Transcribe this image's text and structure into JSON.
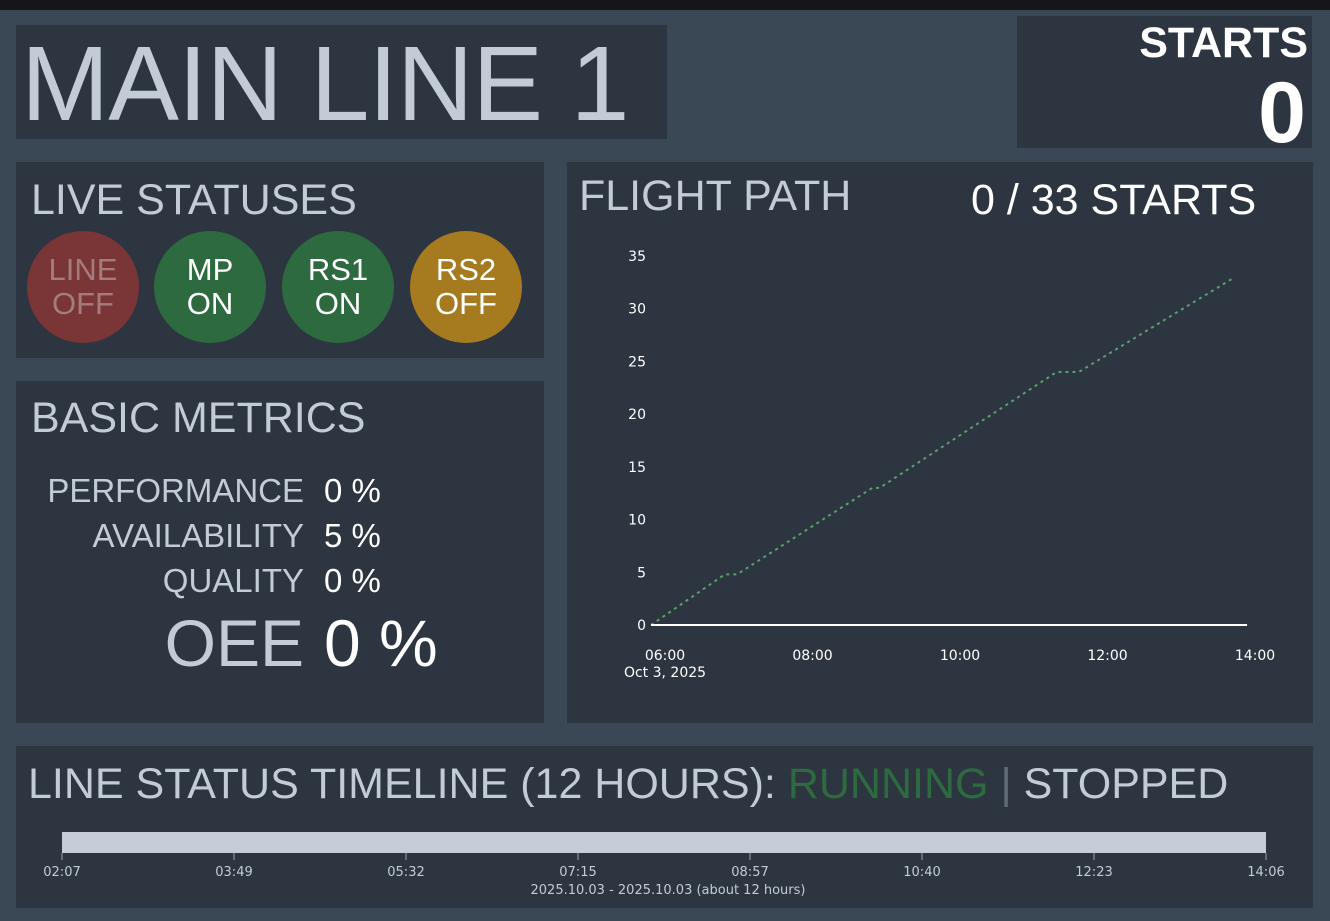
{
  "title": "MAIN LINE 1",
  "starts": {
    "label": "STARTS",
    "value": "0"
  },
  "live_statuses": {
    "title": "LIVE STATUSES",
    "items": [
      {
        "line1": "LINE",
        "line2": "OFF",
        "color": "#7a3536",
        "text_color": "#a57c7d"
      },
      {
        "line1": "MP",
        "line2": "ON",
        "color": "#2e6a3f",
        "text_color": "#ffffff"
      },
      {
        "line1": "RS1",
        "line2": "ON",
        "color": "#2e6a3f",
        "text_color": "#ffffff"
      },
      {
        "line1": "RS2",
        "line2": "OFF",
        "color": "#a67a1f",
        "text_color": "#ffffff"
      }
    ]
  },
  "metrics": {
    "title": "BASIC METRICS",
    "performance": {
      "label": "PERFORMANCE",
      "value": "0 %"
    },
    "availability": {
      "label": "AVAILABILITY",
      "value": "5 %"
    },
    "quality": {
      "label": "QUALITY",
      "value": "0 %"
    },
    "oee": {
      "label": "OEE",
      "value": "0 %"
    }
  },
  "flight_path": {
    "title": "FLIGHT PATH",
    "count_text": "0 / 33 STARTS"
  },
  "chart_data": {
    "type": "line",
    "x_tick_labels": [
      "06:00",
      "08:00",
      "10:00",
      "12:00",
      "14:00"
    ],
    "x_tick_sublabel": "Oct 3, 2025",
    "y_ticks": [
      0,
      5,
      10,
      15,
      20,
      25,
      30,
      35
    ],
    "ylim": [
      0,
      35
    ],
    "xlim": [
      "06:00",
      "14:00"
    ],
    "series": [
      {
        "style": "dotted",
        "color": "#5aa06a",
        "points": [
          {
            "x": "06:00",
            "y": 0
          },
          {
            "x": "07:00",
            "y": 4.8
          },
          {
            "x": "07:10",
            "y": 4.8
          },
          {
            "x": "09:00",
            "y": 13
          },
          {
            "x": "09:06",
            "y": 13
          },
          {
            "x": "11:30",
            "y": 24
          },
          {
            "x": "11:48",
            "y": 24
          },
          {
            "x": "13:55",
            "y": 33
          }
        ]
      },
      {
        "style": "solid",
        "color": "#ffffff",
        "points": [
          {
            "x": "06:00",
            "y": 0
          },
          {
            "x": "14:05",
            "y": 0
          }
        ]
      }
    ]
  },
  "timeline": {
    "title": "LINE STATUS TIMELINE (12 HOURS):",
    "running_label": "RUNNING",
    "separator": "|",
    "stopped_label": "STOPPED",
    "running_color": "#2e6a3f",
    "bar_color": "#c5ced8",
    "tick_labels": [
      "02:07",
      "03:49",
      "05:32",
      "07:15",
      "08:57",
      "10:40",
      "12:23",
      "14:06"
    ],
    "range_label": "2025.10.03 - 2025.10.03 (about 12 hours)"
  }
}
